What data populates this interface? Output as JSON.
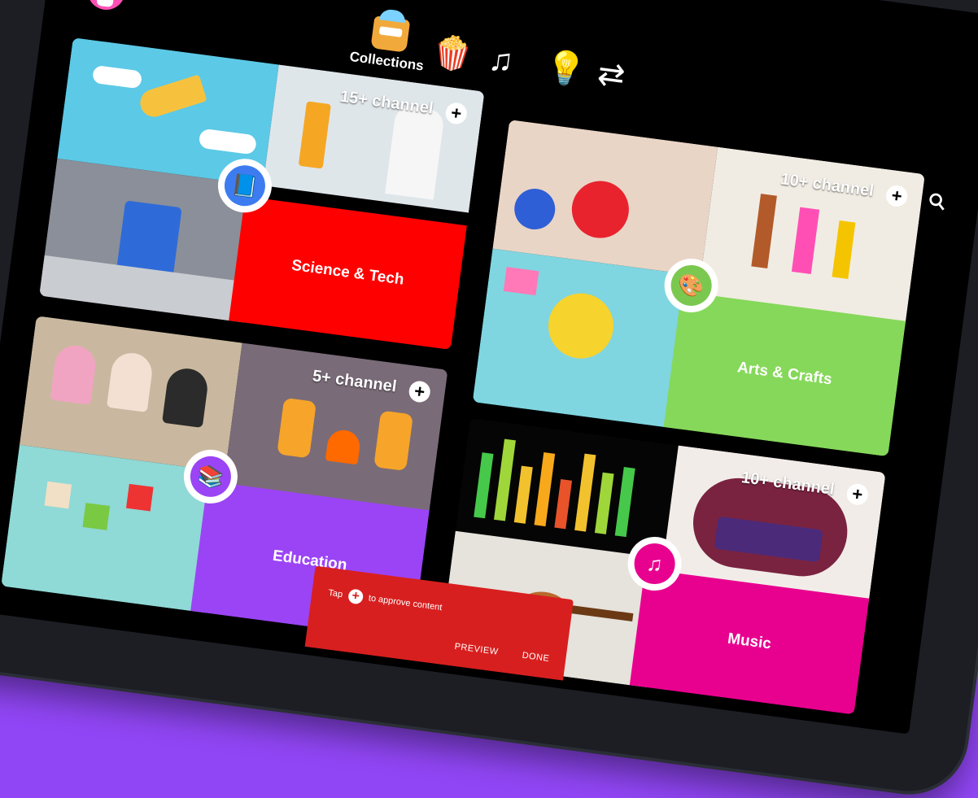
{
  "nav": {
    "collections_label": "Collections",
    "items": [
      {
        "icon": "popcorn-icon",
        "glyph": "🍿"
      },
      {
        "icon": "music-note-icon",
        "glyph": "♫"
      },
      {
        "icon": "lightbulb-icon",
        "glyph": "💡"
      },
      {
        "icon": "explore-arrows-icon",
        "glyph": "⇄"
      }
    ]
  },
  "cards": [
    {
      "name": "Science & Tech",
      "channels": "15+ channel",
      "color": "#ff0000",
      "badge_color": "#3d7cf0",
      "badge_glyph": "📘"
    },
    {
      "name": "Arts & Crafts",
      "channels": "10+ channel",
      "color": "#86d85a",
      "badge_color": "#7bc850",
      "badge_glyph": "🎨"
    },
    {
      "name": "Education",
      "channels": "5+ channel",
      "color": "#9b44f5",
      "badge_color": "#9b44f5",
      "badge_glyph": "📚"
    },
    {
      "name": "Music",
      "channels": "10+ channel",
      "color": "#e8008f",
      "badge_color": "#e8008f",
      "badge_glyph": "♫"
    }
  ],
  "toast": {
    "tap": "Tap",
    "message": "to approve content",
    "preview": "PREVIEW",
    "done": "DONE"
  },
  "colors": {
    "background": "#9146f5",
    "toast": "#d81f1f"
  }
}
